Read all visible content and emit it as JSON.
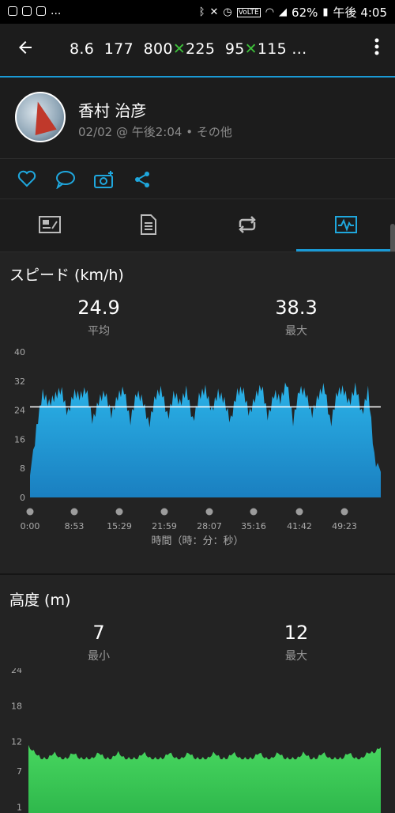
{
  "status_bar": {
    "left_icons": [
      "line-icon",
      "lines-icon",
      "dialer-icon"
    ],
    "left_more": "...",
    "right_icons": [
      "bluetooth-icon",
      "mute-icon",
      "alarm-icon",
      "volte-icon",
      "wifi-icon",
      "signal-icon",
      "battery-icon"
    ],
    "battery": "62%",
    "time": "午後 4:05"
  },
  "header": {
    "back_icon": "back-arrow-icon",
    "title_parts": [
      "8.6  177  800",
      "225  95",
      "115 ..."
    ],
    "x_mark": "✕",
    "more_icon": "more-vert-icon"
  },
  "profile": {
    "name": "香村 治彦",
    "meta": "02/02 @ 午後2:04 • その他"
  },
  "actions": [
    "like-icon",
    "comment-icon",
    "add-photo-icon",
    "share-icon"
  ],
  "tabs": [
    {
      "icon": "overview-icon",
      "active": false
    },
    {
      "icon": "details-icon",
      "active": false
    },
    {
      "icon": "laps-icon",
      "active": false
    },
    {
      "icon": "charts-icon",
      "active": true
    }
  ],
  "speed": {
    "title": "スピード (km/h)",
    "avg_value": "24.9",
    "avg_label": "平均",
    "max_value": "38.3",
    "max_label": "最大",
    "axis_title": "時間（時：分：秒）"
  },
  "elevation": {
    "title": "高度 (m)",
    "min_value": "7",
    "min_label": "最小",
    "max_value": "12",
    "max_label": "最大"
  },
  "chart_data": [
    {
      "type": "area",
      "title": "スピード (km/h)",
      "ylabel": "",
      "xlabel": "時間（時：分：秒）",
      "ylim": [
        0,
        40
      ],
      "yticks": [
        0,
        8,
        16,
        24,
        32,
        40
      ],
      "xticks": [
        "0:00",
        "8:53",
        "15:29",
        "21:59",
        "28:07",
        "35:16",
        "41:42",
        "49:23"
      ],
      "average_line": 24.9,
      "color": "#1fa7dd",
      "x_minutes": [
        0,
        1,
        2,
        3,
        4,
        5,
        6,
        7,
        8,
        9,
        10,
        11,
        12,
        13,
        14,
        15,
        16,
        17,
        18,
        19,
        20,
        21,
        22,
        23,
        24,
        25,
        26,
        27,
        28,
        29,
        30,
        31,
        32,
        33,
        34,
        35,
        36,
        37,
        38,
        39,
        40,
        41,
        42,
        43,
        44,
        45,
        46,
        47,
        48,
        49,
        50,
        51,
        52,
        53,
        54,
        55,
        56
      ],
      "values": [
        6,
        20,
        30,
        27,
        29,
        31,
        24,
        30,
        29,
        31,
        22,
        28,
        30,
        24,
        29,
        31,
        22,
        30,
        28,
        21,
        29,
        31,
        23,
        30,
        27,
        31,
        22,
        29,
        31,
        25,
        30,
        28,
        22,
        30,
        31,
        24,
        29,
        32,
        23,
        30,
        28,
        33,
        22,
        31,
        30,
        24,
        29,
        32,
        21,
        30,
        31,
        27,
        32,
        24,
        31,
        12,
        7
      ]
    },
    {
      "type": "area",
      "title": "高度 (m)",
      "ylabel": "",
      "ylim": [
        0,
        24
      ],
      "yticks": [
        1,
        7,
        12,
        18,
        24
      ],
      "color": "#3dcc5a",
      "values": [
        11,
        10,
        9,
        9,
        10,
        9,
        9,
        10,
        9,
        9,
        9,
        10,
        9,
        9,
        10,
        9,
        9,
        9,
        10,
        9,
        9,
        9,
        10,
        9,
        9,
        10,
        9,
        9,
        9,
        10,
        9,
        9,
        10,
        9,
        9,
        9,
        10,
        9,
        9,
        10,
        9,
        9,
        9,
        10,
        9,
        9,
        10,
        9,
        9,
        9,
        10,
        9,
        9,
        10,
        10,
        11
      ]
    }
  ]
}
